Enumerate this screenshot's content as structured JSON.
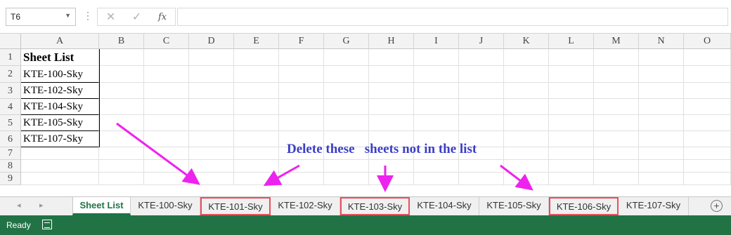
{
  "formula_bar": {
    "name_box": "T6",
    "cancel_glyph": "✕",
    "enter_glyph": "✓",
    "fx_label": "fx",
    "formula_value": ""
  },
  "columns": [
    "A",
    "B",
    "C",
    "D",
    "E",
    "F",
    "G",
    "H",
    "I",
    "J",
    "K",
    "L",
    "M",
    "N",
    "O"
  ],
  "rows": [
    "1",
    "2",
    "3",
    "4",
    "5",
    "6",
    "7",
    "8",
    "9"
  ],
  "cells": {
    "A1": "Sheet List",
    "A2": "KTE-100-Sky",
    "A3": "KTE-102-Sky",
    "A4": "KTE-104-Sky",
    "A5": "KTE-105-Sky",
    "A6": "KTE-107-Sky"
  },
  "annotation": "Delete these   sheets not in the list",
  "tabs": [
    {
      "label": "Sheet List",
      "active": true,
      "highlighted": false
    },
    {
      "label": "KTE-100-Sky",
      "active": false,
      "highlighted": false
    },
    {
      "label": "KTE-101-Sky",
      "active": false,
      "highlighted": true
    },
    {
      "label": "KTE-102-Sky",
      "active": false,
      "highlighted": false
    },
    {
      "label": "KTE-103-Sky",
      "active": false,
      "highlighted": true
    },
    {
      "label": "KTE-104-Sky",
      "active": false,
      "highlighted": false
    },
    {
      "label": "KTE-105-Sky",
      "active": false,
      "highlighted": false
    },
    {
      "label": "KTE-106-Sky",
      "active": false,
      "highlighted": true
    },
    {
      "label": "KTE-107-Sky",
      "active": false,
      "highlighted": false
    }
  ],
  "status": {
    "ready": "Ready"
  },
  "colors": {
    "excel_green": "#217346",
    "annotation": "#3b3fc4",
    "arrow": "#ee22ee",
    "highlight": "#e8505b"
  }
}
